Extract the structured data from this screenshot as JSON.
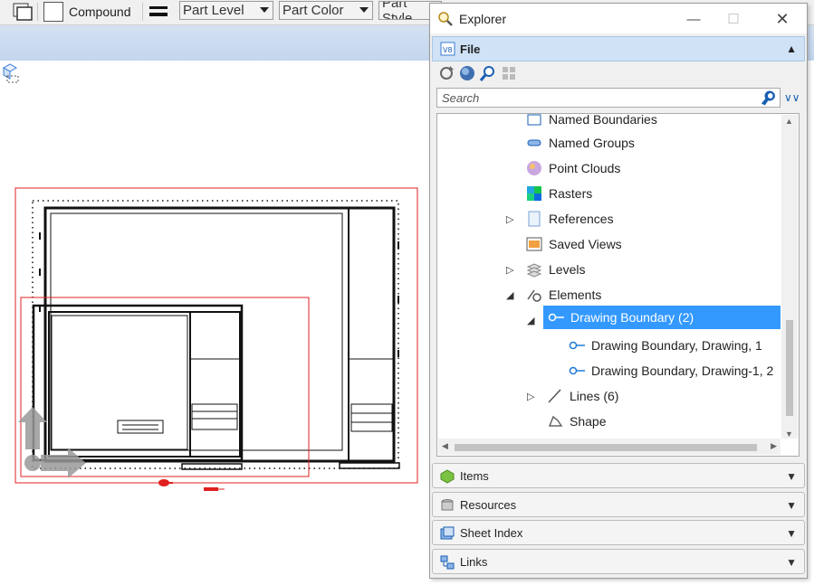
{
  "toolbar": {
    "compound_label": "Compound",
    "level_combo": "Part Level",
    "color_combo": "Part Color",
    "style_combo": "Part Style"
  },
  "explorer": {
    "title": "Explorer",
    "file_section": "File",
    "search_placeholder": "Search",
    "tree": [
      {
        "label": "Named Boundaries"
      },
      {
        "label": "Named Groups"
      },
      {
        "label": "Point Clouds"
      },
      {
        "label": "Rasters"
      },
      {
        "label": "References"
      },
      {
        "label": "Saved Views"
      },
      {
        "label": "Levels"
      },
      {
        "label": "Elements"
      },
      {
        "label": "Drawing Boundary (2)"
      },
      {
        "label": "Drawing Boundary, Drawing, 1"
      },
      {
        "label": "Drawing Boundary, Drawing-1, 2"
      },
      {
        "label": "Lines (6)"
      },
      {
        "label": "Shape"
      }
    ],
    "sections": [
      {
        "label": "Items",
        "icon": "items-icon"
      },
      {
        "label": "Resources",
        "icon": "resources-icon"
      },
      {
        "label": "Sheet Index",
        "icon": "sheet-index-icon"
      },
      {
        "label": "Links",
        "icon": "links-icon"
      }
    ]
  },
  "colors": {
    "selection": "#3399ff",
    "boundary_red": "#e02020",
    "file_header": "#cfe2f6"
  }
}
